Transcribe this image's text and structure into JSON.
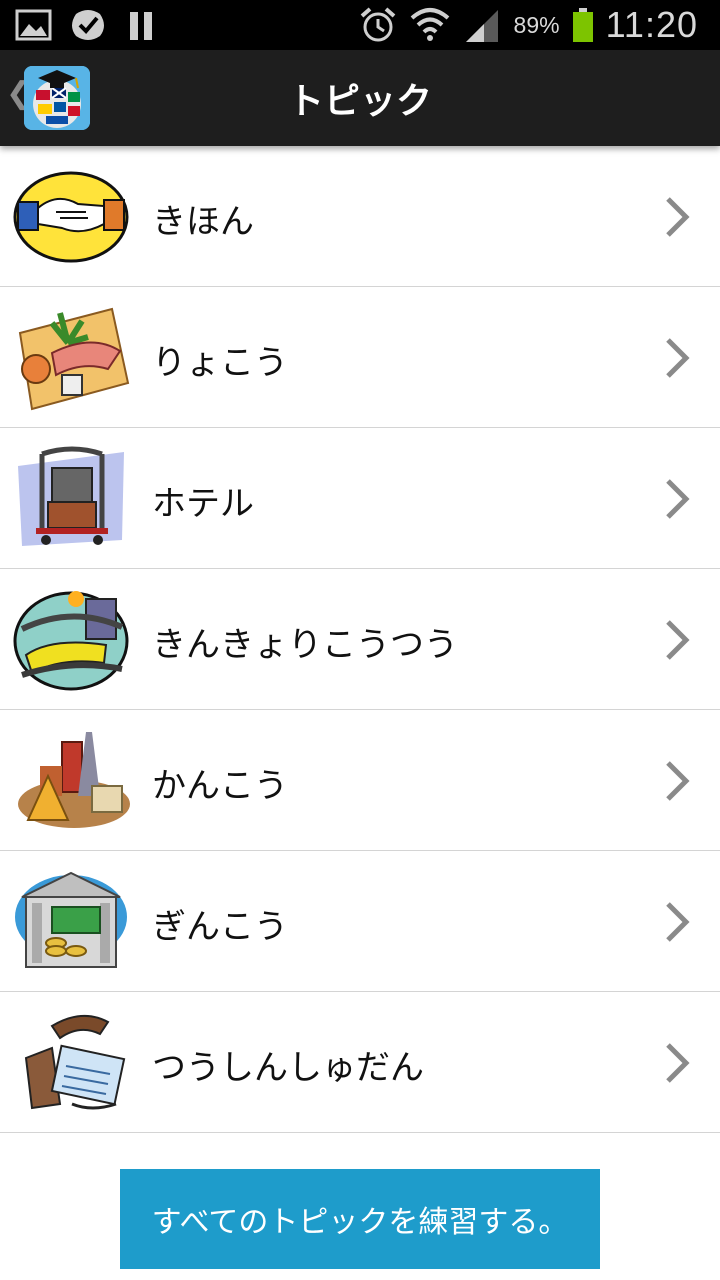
{
  "status_bar": {
    "battery_percent": "89%",
    "time": "11:20",
    "battery_level": 0.89,
    "battery_color": "#7dc400"
  },
  "action_bar": {
    "title": "トピック",
    "app_icon": "globe-flags-graduation-cap-icon"
  },
  "topics": [
    {
      "label": "きほん",
      "icon": "handshake-icon"
    },
    {
      "label": "りょこう",
      "icon": "beach-travel-icon"
    },
    {
      "label": "ホテル",
      "icon": "luggage-cart-icon"
    },
    {
      "label": "きんきょりこうつう",
      "icon": "train-transit-icon"
    },
    {
      "label": "かんこう",
      "icon": "landmarks-sightseeing-icon"
    },
    {
      "label": "ぎんこう",
      "icon": "bank-building-icon"
    },
    {
      "label": "つうしんしゅだん",
      "icon": "telephone-icon"
    }
  ],
  "practice_button": {
    "label": "すべてのトピックを練習する。"
  },
  "colors": {
    "accent": "#1e9ccb",
    "action_bar": "#1e1e1e",
    "divider": "#d4d4d4"
  }
}
